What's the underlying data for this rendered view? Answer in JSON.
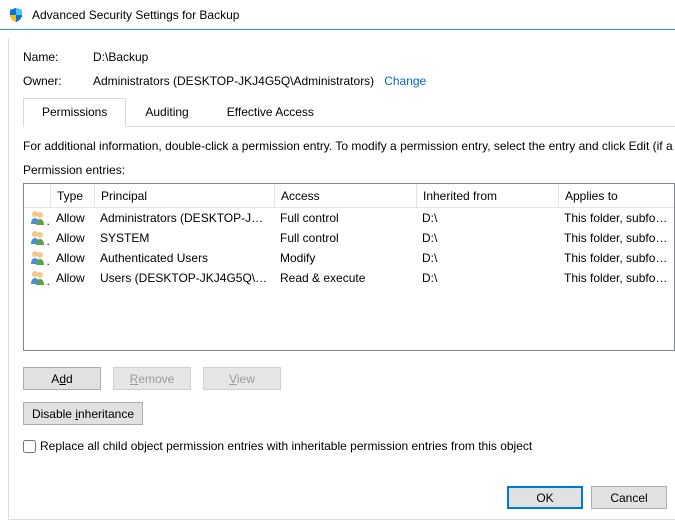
{
  "window": {
    "title": "Advanced Security Settings for Backup"
  },
  "fields": {
    "name_label": "Name:",
    "name_value": "D:\\Backup",
    "owner_label": "Owner:",
    "owner_value": "Administrators (DESKTOP-JKJ4G5Q\\Administrators)",
    "change_link": "Change"
  },
  "tabs": {
    "permissions": "Permissions",
    "auditing": "Auditing",
    "effective": "Effective Access"
  },
  "info_text": "For additional information, double-click a permission entry. To modify a permission entry, select the entry and click Edit (if a",
  "entries_label": "Permission entries:",
  "columns": {
    "type": "Type",
    "principal": "Principal",
    "access": "Access",
    "inherited": "Inherited from",
    "applies": "Applies to"
  },
  "rows": [
    {
      "type": "Allow",
      "principal": "Administrators (DESKTOP-JKJ...",
      "access": "Full control",
      "inherited": "D:\\",
      "applies": "This folder, subfolder"
    },
    {
      "type": "Allow",
      "principal": "SYSTEM",
      "access": "Full control",
      "inherited": "D:\\",
      "applies": "This folder, subfolder"
    },
    {
      "type": "Allow",
      "principal": "Authenticated Users",
      "access": "Modify",
      "inherited": "D:\\",
      "applies": "This folder, subfolder"
    },
    {
      "type": "Allow",
      "principal": "Users (DESKTOP-JKJ4G5Q\\Use...",
      "access": "Read & execute",
      "inherited": "D:\\",
      "applies": "This folder, subfolder"
    }
  ],
  "buttons": {
    "add": "Add",
    "remove": "Remove",
    "view": "View",
    "disable_inheritance": "Disable inheritance",
    "ok": "OK",
    "cancel": "Cancel"
  },
  "checkbox": {
    "label": "Replace all child object permission entries with inheritable permission entries from this object"
  }
}
